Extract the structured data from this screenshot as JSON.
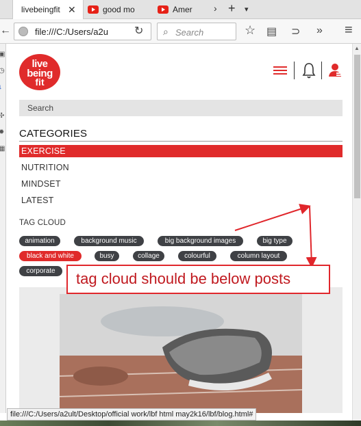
{
  "browser": {
    "tabs": [
      {
        "title": "livebeingfit",
        "close": "✕"
      },
      {
        "title": "good mo"
      },
      {
        "title": "Amer"
      }
    ],
    "tab_glyphs": {
      "scroll": "›",
      "new_tab": "+",
      "list": "▾"
    },
    "nav": {
      "back": "←",
      "url": "file:///C:/Users/a2u",
      "reload": "↻",
      "search_placeholder": "Search",
      "search_glyph": "⌕",
      "bookmark": "☆",
      "reader": "▤",
      "link": "⊃",
      "overflow": "»",
      "menu": "≡"
    },
    "status_url": "file:///C:/Users/a2ult/Desktop/official work/lbf html may2k16/lbf/blog.html#"
  },
  "site": {
    "logo": {
      "line1": "live",
      "line2": "being",
      "line3": "fit"
    },
    "search_label": "Search",
    "categories_title": "CATEGORIES",
    "categories": [
      {
        "label": "EXERCISE",
        "active": true
      },
      {
        "label": "NUTRITION",
        "active": false
      },
      {
        "label": "MINDSET",
        "active": false
      },
      {
        "label": "LATEST",
        "active": false
      }
    ],
    "tag_cloud_title": "TAG CLOUD",
    "tags": [
      {
        "label": "animation",
        "active": false
      },
      {
        "label": "background music",
        "active": false
      },
      {
        "label": "big background images",
        "active": false
      },
      {
        "label": "big type",
        "active": false
      },
      {
        "label": "black and white",
        "active": true
      },
      {
        "label": "busy",
        "active": false
      },
      {
        "label": "collage",
        "active": false
      },
      {
        "label": "colourful",
        "active": false
      },
      {
        "label": "column layout",
        "active": false
      },
      {
        "label": "corporate",
        "active": false
      }
    ]
  },
  "annotation": {
    "text": "tag cloud should be below posts",
    "color": "#e0262b"
  },
  "colors": {
    "brand_red": "#e02b2b",
    "tag_dark": "#3f4145"
  }
}
